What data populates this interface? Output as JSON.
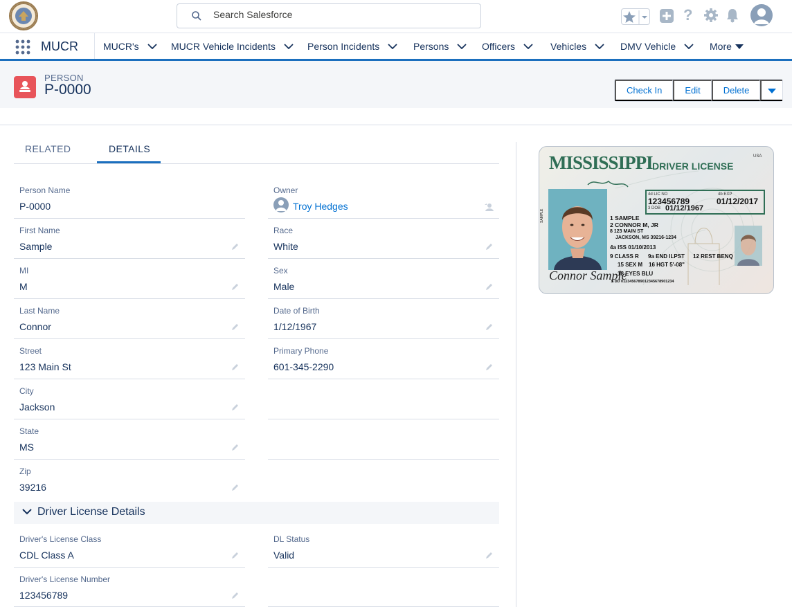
{
  "header": {
    "search_placeholder": "Search Salesforce"
  },
  "nav": {
    "app_name": "MUCR",
    "items": [
      {
        "label": "MUCR's"
      },
      {
        "label": "MUCR Vehicle Incidents"
      },
      {
        "label": "Person Incidents"
      },
      {
        "label": "Persons"
      },
      {
        "label": "Officers"
      },
      {
        "label": "Vehicles"
      },
      {
        "label": "DMV Vehicle"
      },
      {
        "label": "More"
      }
    ]
  },
  "record": {
    "type": "PERSON",
    "name": "P-0000",
    "actions": {
      "check_in": "Check In",
      "edit": "Edit",
      "delete": "Delete"
    }
  },
  "tabs": {
    "related": "RELATED",
    "details": "DETAILS",
    "active": "details"
  },
  "fields": {
    "person_name": {
      "label": "Person Name",
      "value": "P-0000"
    },
    "owner": {
      "label": "Owner",
      "value": "Troy Hedges"
    },
    "first_name": {
      "label": "First Name",
      "value": "Sample"
    },
    "race": {
      "label": "Race",
      "value": "White"
    },
    "mi": {
      "label": "MI",
      "value": "M"
    },
    "sex": {
      "label": "Sex",
      "value": "Male"
    },
    "last_name": {
      "label": "Last Name",
      "value": "Connor"
    },
    "dob": {
      "label": "Date of Birth",
      "value": "1/12/1967"
    },
    "street": {
      "label": "Street",
      "value": "123 Main St"
    },
    "phone": {
      "label": "Primary Phone",
      "value": "601-345-2290"
    },
    "city": {
      "label": "City",
      "value": "Jackson"
    },
    "state": {
      "label": "State",
      "value": "MS"
    },
    "zip": {
      "label": "Zip",
      "value": "39216"
    },
    "dl_class": {
      "label": "Driver's License Class",
      "value": "CDL Class A"
    },
    "dl_status": {
      "label": "DL Status",
      "value": "Valid"
    },
    "dl_number": {
      "label": "Driver's License Number",
      "value": "123456789"
    }
  },
  "section": {
    "title": "Driver License Details"
  },
  "license": {
    "state": "MISSISSIPPI",
    "title": "DRIVER LICENSE",
    "usa": "USA",
    "lic_no_label": "4d LIC NO",
    "lic_no": "123456789",
    "exp_label": "4b EXP",
    "exp": "01/12/2017",
    "dob_label": "3 DOB",
    "dob": "01/12/1967",
    "line1": "1 SAMPLE",
    "line2": "2 CONNOR M, JR",
    "line3": "8 123 MAIN ST",
    "line4": "JACKSON, MS 39216-1234",
    "iss": "4a ISS 01/10/2013",
    "class": "9 CLASS R",
    "end": "9a END ILPST",
    "rest": "12 REST BENQ",
    "sex": "15 SEX M",
    "hgt": "16 HGT 5'-08\"",
    "eyes": "18 EYES BLU",
    "dd": "5 DD 0123456789012345678901234",
    "photo_label": "SAMPLE",
    "signature": "Connor Sample"
  }
}
